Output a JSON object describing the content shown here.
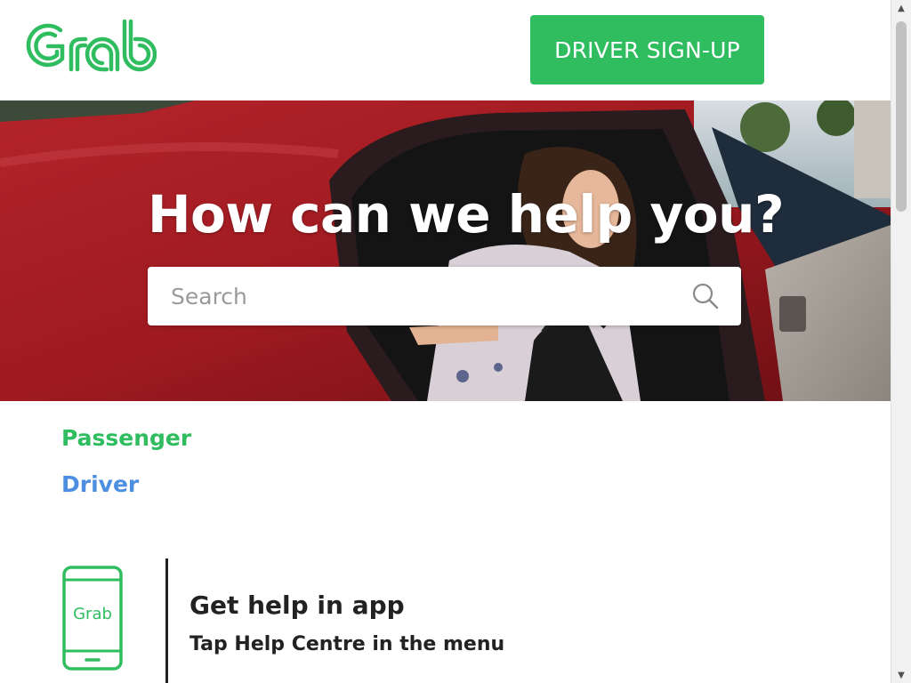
{
  "header": {
    "logo_text": "Grab",
    "signup_label": "DRIVER SIGN-UP"
  },
  "hero": {
    "title": "How can we help you?",
    "search_placeholder": "Search"
  },
  "links": {
    "passenger": "Passenger",
    "driver": "Driver"
  },
  "app_help": {
    "title": "Get help in app",
    "subtitle": "Tap Help Centre in the menu",
    "phone_logo_text": "Grab"
  },
  "colors": {
    "brand_green": "#2fbd60",
    "driver_blue": "#4c8fe0",
    "text_dark": "#222222"
  },
  "icons": {
    "search": "search-icon",
    "phone": "phone-icon",
    "logo": "grab-logo"
  }
}
